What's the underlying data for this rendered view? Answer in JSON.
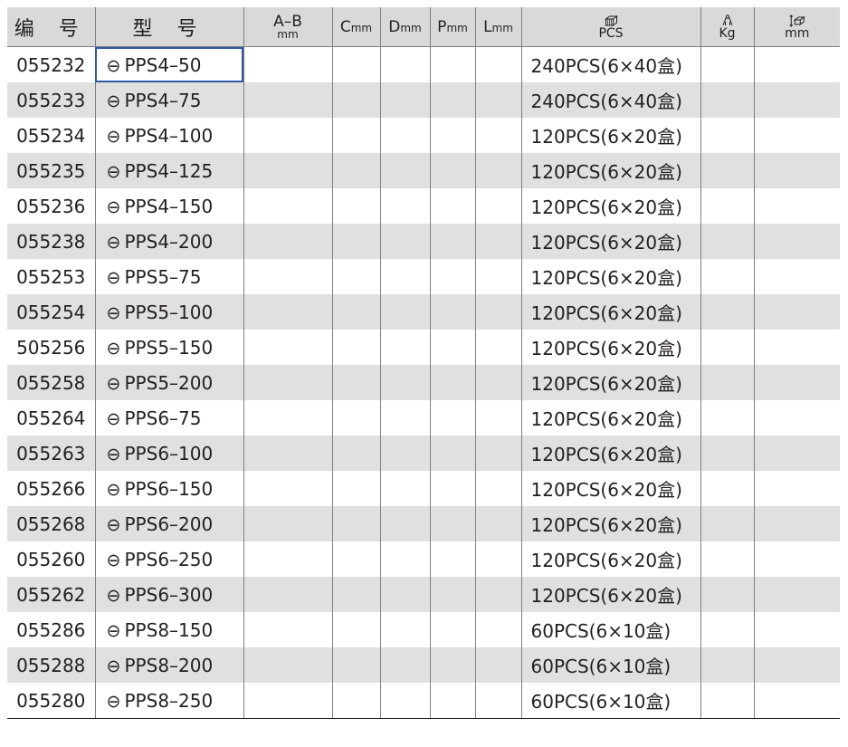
{
  "header": {
    "code": "编 号",
    "model": "型 号",
    "ab_main": "A–B",
    "ab_unit": "mm",
    "c_letter": "C",
    "c_unit": "mm",
    "d_letter": "D",
    "d_unit": "mm",
    "p_letter": "P",
    "p_unit": "mm",
    "l_letter": "L",
    "l_unit": "mm",
    "pack_label": "PCS",
    "weight_label": "Kg",
    "size_label": "mm",
    "icons": {
      "pack": "box-stack-icon",
      "weight": "weight-icon",
      "size": "dimension-icon"
    }
  },
  "symbol": "⊖",
  "rows": [
    {
      "code": "055232",
      "model": "PPS4–50",
      "pack": "240PCS(6×40盒)"
    },
    {
      "code": "055233",
      "model": "PPS4–75",
      "pack": "240PCS(6×40盒)"
    },
    {
      "code": "055234",
      "model": "PPS4–100",
      "pack": "120PCS(6×20盒)"
    },
    {
      "code": "055235",
      "model": "PPS4–125",
      "pack": "120PCS(6×20盒)"
    },
    {
      "code": "055236",
      "model": "PPS4–150",
      "pack": "120PCS(6×20盒)"
    },
    {
      "code": "055238",
      "model": "PPS4–200",
      "pack": "120PCS(6×20盒)"
    },
    {
      "code": "055253",
      "model": "PPS5–75",
      "pack": "120PCS(6×20盒)"
    },
    {
      "code": "055254",
      "model": "PPS5–100",
      "pack": "120PCS(6×20盒)"
    },
    {
      "code": "505256",
      "model": "PPS5–150",
      "pack": "120PCS(6×20盒)"
    },
    {
      "code": "055258",
      "model": "PPS5–200",
      "pack": "120PCS(6×20盒)"
    },
    {
      "code": "055264",
      "model": "PPS6–75",
      "pack": "120PCS(6×20盒)"
    },
    {
      "code": "055263",
      "model": "PPS6–100",
      "pack": "120PCS(6×20盒)"
    },
    {
      "code": "055266",
      "model": "PPS6–150",
      "pack": "120PCS(6×20盒)"
    },
    {
      "code": "055268",
      "model": "PPS6–200",
      "pack": "120PCS(6×20盒)"
    },
    {
      "code": "055260",
      "model": "PPS6–250",
      "pack": "120PCS(6×20盒)"
    },
    {
      "code": "055262",
      "model": "PPS6–300",
      "pack": "120PCS(6×20盒)"
    },
    {
      "code": "055286",
      "model": "PPS8–150",
      "pack": "60PCS(6×10盒)"
    },
    {
      "code": "055288",
      "model": "PPS8–200",
      "pack": "60PCS(6×10盒)"
    },
    {
      "code": "055280",
      "model": "PPS8–250",
      "pack": "60PCS(6×10盒)"
    }
  ],
  "colors": {
    "header_bg": "#d9d9d9",
    "stripe_bg": "#e0e0e0",
    "selection": "#2f57a3",
    "text": "#231f20"
  }
}
